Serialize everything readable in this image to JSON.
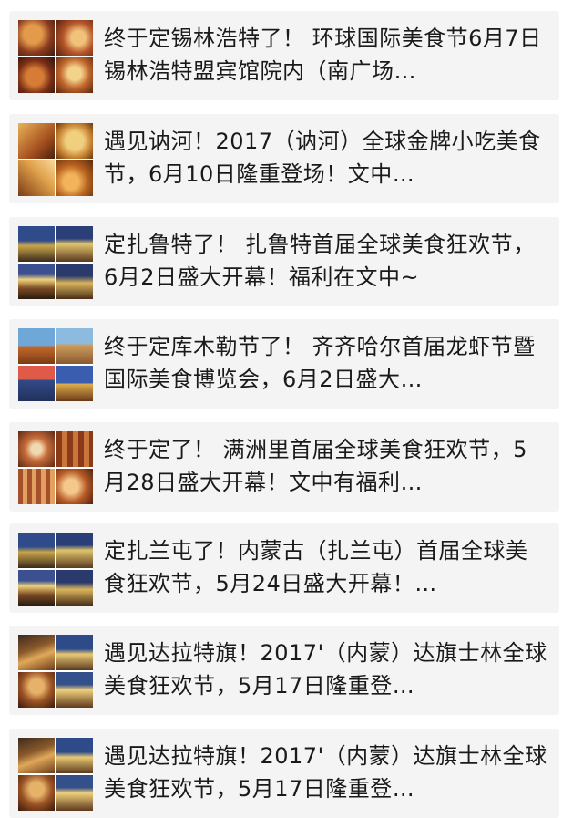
{
  "articles": [
    {
      "title": "终于定锡林浩特了！ 环球国际美食节6月7日锡林浩特盟宾馆院内（南广场…",
      "thumbnail": "food-collage-thumbnail"
    },
    {
      "title": "遇见讷河！2017（讷河）全球金牌小吃美食节，6月10日隆重登场！文中…",
      "thumbnail": "food-collage-thumbnail"
    },
    {
      "title": "定扎鲁特了！ 扎鲁特首届全球美食狂欢节， 6月2日盛大开幕！福利在文中~",
      "thumbnail": "night-market-thumbnail"
    },
    {
      "title": "终于定库木勒节了！ 齐齐哈尔首届龙虾节暨国际美食博览会，6月2日盛大…",
      "thumbnail": "festival-thumbnail"
    },
    {
      "title": "终于定了！ 满洲里首届全球美食狂欢节，5月28日盛大开幕！文中有福利…",
      "thumbnail": "bbq-thumbnail"
    },
    {
      "title": "定扎兰屯了！内蒙古（扎兰屯）首届全球美食狂欢节，5月24日盛大开幕！…",
      "thumbnail": "night-market-thumbnail"
    },
    {
      "title": "遇见达拉特旗！2017'（内蒙）达旗士林全球美食狂欢节，5月17日隆重登…",
      "thumbnail": "grill-market-thumbnail"
    },
    {
      "title": "遇见达拉特旗！2017'（内蒙）达旗士林全球美食狂欢节，5月17日隆重登…",
      "thumbnail": "grill-market-thumbnail"
    }
  ]
}
